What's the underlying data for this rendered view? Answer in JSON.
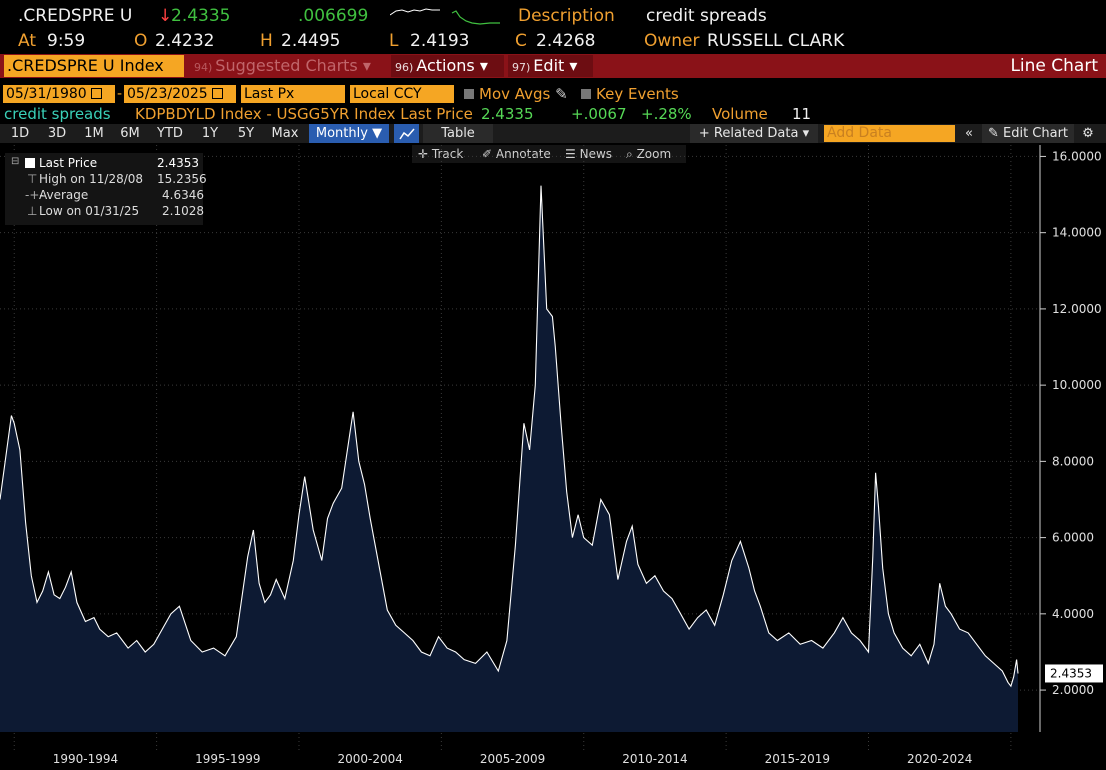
{
  "header": {
    "ticker": ".CREDSPRE U",
    "arrow": "↓",
    "last": "2.4335",
    "change": ".006699",
    "desc_label": "Description",
    "desc_value": "credit spreads",
    "at_label": "At",
    "time": "9:59",
    "o_label": "O",
    "open": "2.4232",
    "h_label": "H",
    "high": "2.4495",
    "l_label": "L",
    "low": "2.4193",
    "c_label": "C",
    "close": "2.4268",
    "owner_label": "Owner",
    "owner": "RUSSELL CLARK"
  },
  "menu": {
    "ticker_tab": ".CREDSPRE U Index",
    "suggested_num": "94)",
    "suggested": "Suggested Charts",
    "actions_num": "96)",
    "actions": "Actions",
    "edit_num": "97)",
    "edit": "Edit",
    "title": "Line Chart"
  },
  "fields": {
    "start_date": "05/31/1980",
    "dash": "-",
    "end_date": "05/23/2025",
    "price_field": "Last Px",
    "currency": "Local CCY",
    "mov_avgs": "Mov Avgs",
    "key_events": "Key Events"
  },
  "info": {
    "name": "credit spreads",
    "formula": "KDPBDYLD Index - USGG5YR Index Last Price",
    "price": "2.4335",
    "change": "+.0067",
    "pct": "+.28%",
    "volume_label": "Volume",
    "volume": "11"
  },
  "periods": [
    "1D",
    "3D",
    "1M",
    "6M",
    "YTD",
    "1Y",
    "5Y",
    "Max"
  ],
  "frequency": "Monthly",
  "table_label": "Table",
  "related_data": "Related Data",
  "add_data_placeholder": "Add Data",
  "edit_chart": "Edit Chart",
  "tools": {
    "track": "Track",
    "annotate": "Annotate",
    "news": "News",
    "zoom": "Zoom"
  },
  "legend": {
    "last_label": "Last Price",
    "last_value": "2.4353",
    "high_label": "High on 11/28/08",
    "high_value": "15.2356",
    "avg_label": "Average",
    "avg_value": "4.6346",
    "low_label": "Low on 01/31/25",
    "low_value": "2.1028"
  },
  "colors": {
    "accent": "#f5a623",
    "menu": "#8a1218",
    "fill": "#0d1a33",
    "line": "#ffffff"
  },
  "chart_data": {
    "type": "area",
    "last_label": "2.4353",
    "y_ticks": [
      "16.0000",
      "14.0000",
      "12.0000",
      "10.0000",
      "8.0000",
      "6.0000",
      "4.0000",
      "2.0000"
    ],
    "x_labels": [
      "1990-1994",
      "1995-1999",
      "2000-2004",
      "2005-2009",
      "2010-2014",
      "2015-2019",
      "2020-2024"
    ],
    "ylim": [
      0.9,
      16.3
    ],
    "xlim": [
      1989.5,
      2025.25
    ],
    "grid": true,
    "series": [
      {
        "x": [
          1989.5,
          1989.7,
          1989.9,
          1990.0,
          1990.2,
          1990.4,
          1990.6,
          1990.8,
          1991.0,
          1991.2,
          1991.4,
          1991.6,
          1991.8,
          1992.0,
          1992.2,
          1992.5,
          1992.8,
          1993.0,
          1993.3,
          1993.6,
          1994.0,
          1994.3,
          1994.6,
          1994.9,
          1995.2,
          1995.5,
          1995.8,
          1996.2,
          1996.6,
          1997.0,
          1997.4,
          1997.8,
          1998.2,
          1998.4,
          1998.6,
          1998.8,
          1999.0,
          1999.2,
          1999.5,
          1999.8,
          2000.0,
          2000.2,
          2000.5,
          2000.8,
          2001.0,
          2001.2,
          2001.5,
          2001.7,
          2001.9,
          2002.1,
          2002.3,
          2002.5,
          2002.7,
          2002.9,
          2003.1,
          2003.4,
          2003.7,
          2004.0,
          2004.3,
          2004.6,
          2004.9,
          2005.2,
          2005.5,
          2005.8,
          2006.2,
          2006.6,
          2007.0,
          2007.3,
          2007.6,
          2007.9,
          2008.1,
          2008.3,
          2008.5,
          2008.7,
          2008.9,
          2009.0,
          2009.2,
          2009.4,
          2009.6,
          2009.8,
          2010.0,
          2010.3,
          2010.6,
          2010.9,
          2011.2,
          2011.5,
          2011.7,
          2011.9,
          2012.2,
          2012.5,
          2012.8,
          2013.1,
          2013.4,
          2013.7,
          2014.0,
          2014.3,
          2014.6,
          2014.9,
          2015.2,
          2015.5,
          2015.8,
          2016.0,
          2016.2,
          2016.5,
          2016.8,
          2017.2,
          2017.6,
          2018.0,
          2018.4,
          2018.8,
          2019.1,
          2019.4,
          2019.7,
          2020.0,
          2020.15,
          2020.25,
          2020.35,
          2020.5,
          2020.7,
          2020.9,
          2021.2,
          2021.5,
          2021.8,
          2022.1,
          2022.3,
          2022.5,
          2022.7,
          2022.9,
          2023.2,
          2023.5,
          2023.8,
          2024.1,
          2024.4,
          2024.7,
          2024.9,
          2025.0,
          2025.1,
          2025.2,
          2025.25
        ],
        "y": [
          7.0,
          8.1,
          9.2,
          9.0,
          8.3,
          6.4,
          5.0,
          4.3,
          4.6,
          5.1,
          4.5,
          4.4,
          4.7,
          5.1,
          4.3,
          3.8,
          3.9,
          3.6,
          3.4,
          3.5,
          3.1,
          3.3,
          3.0,
          3.2,
          3.6,
          4.0,
          4.2,
          3.3,
          3.0,
          3.1,
          2.9,
          3.4,
          5.5,
          6.2,
          4.8,
          4.3,
          4.5,
          4.9,
          4.4,
          5.4,
          6.6,
          7.6,
          6.2,
          5.4,
          6.5,
          6.9,
          7.3,
          8.3,
          9.3,
          8.0,
          7.4,
          6.5,
          5.7,
          4.9,
          4.1,
          3.7,
          3.5,
          3.3,
          3.0,
          2.9,
          3.4,
          3.1,
          3.0,
          2.8,
          2.7,
          3.0,
          2.5,
          3.3,
          5.8,
          9.0,
          8.3,
          10.0,
          15.2356,
          12.0,
          11.8,
          11.0,
          9.0,
          7.2,
          6.0,
          6.6,
          6.0,
          5.8,
          7.0,
          6.6,
          4.9,
          5.9,
          6.3,
          5.3,
          4.8,
          5.0,
          4.6,
          4.4,
          4.0,
          3.6,
          3.9,
          4.1,
          3.7,
          4.5,
          5.4,
          5.9,
          5.2,
          4.6,
          4.2,
          3.5,
          3.3,
          3.5,
          3.2,
          3.3,
          3.1,
          3.5,
          3.9,
          3.5,
          3.3,
          3.0,
          5.5,
          7.7,
          6.8,
          5.2,
          4.0,
          3.5,
          3.1,
          2.9,
          3.2,
          2.7,
          3.2,
          4.8,
          4.2,
          4.0,
          3.6,
          3.5,
          3.2,
          2.9,
          2.7,
          2.5,
          2.2,
          2.1028,
          2.35,
          2.8,
          2.4353
        ]
      }
    ]
  }
}
